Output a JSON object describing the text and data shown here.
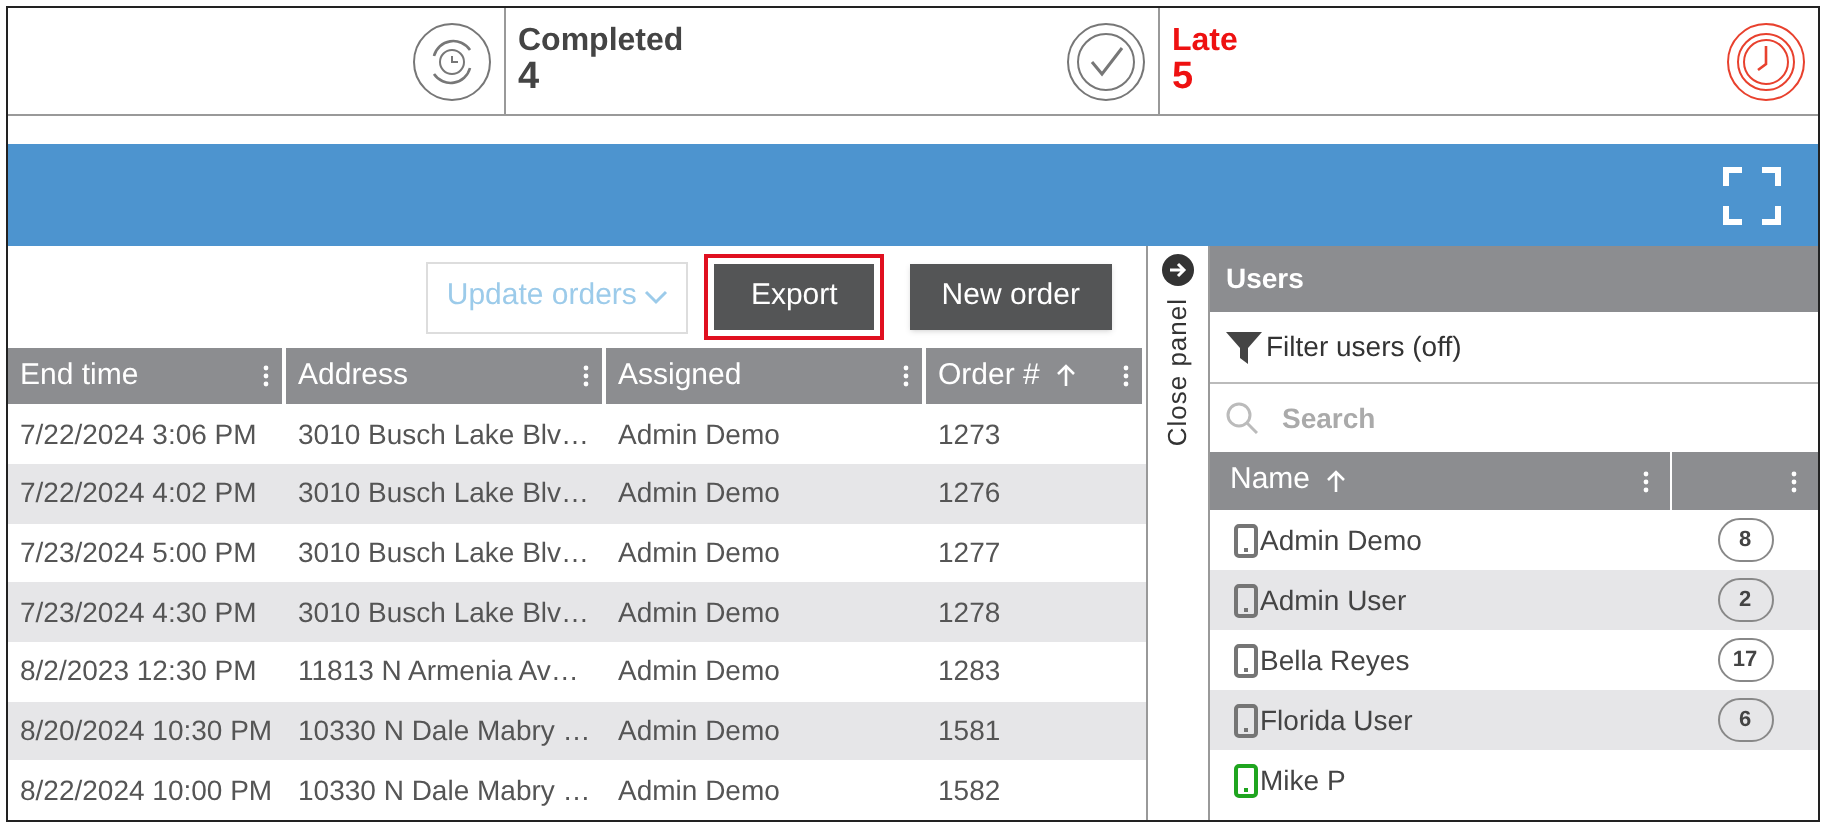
{
  "stats": [
    {
      "kind": "in_progress"
    },
    {
      "kind": "completed",
      "label": "Completed",
      "value": "4"
    },
    {
      "kind": "late",
      "label": "Late",
      "value": "5"
    }
  ],
  "toolbar": {
    "update": {
      "label": "Update orders",
      "disabled": true
    },
    "buttons": [
      {
        "label": "Export",
        "highlighted": true
      },
      {
        "label": "New order",
        "highlighted": false
      }
    ]
  },
  "table": {
    "columns": [
      {
        "label": "End time",
        "sorted": false
      },
      {
        "label": "Address",
        "sorted": false
      },
      {
        "label": "Assigned",
        "sorted": false
      },
      {
        "label": "Order #",
        "sorted": true
      }
    ],
    "rows": [
      [
        "7/22/2024 3:06 PM",
        "3010 Busch Lake Blv…",
        "Admin Demo",
        "1273"
      ],
      [
        "7/22/2024 4:02 PM",
        "3010 Busch Lake Blv…",
        "Admin Demo",
        "1276"
      ],
      [
        "7/23/2024 5:00 PM",
        "3010 Busch Lake Blv…",
        "Admin Demo",
        "1277"
      ],
      [
        "7/23/2024 4:30 PM",
        "3010 Busch Lake Blv…",
        "Admin Demo",
        "1278"
      ],
      [
        "8/2/2023 12:30 PM",
        "11813 N Armenia Av…",
        "Admin Demo",
        "1283"
      ],
      [
        "8/20/2024 10:30 PM",
        "10330 N Dale Mabry …",
        "Admin Demo",
        "1581"
      ],
      [
        "8/22/2024 10:00 PM",
        "10330 N Dale Mabry …",
        "Admin Demo",
        "1582"
      ]
    ]
  },
  "close_panel": "Close panel",
  "users": {
    "title": "Users",
    "filter": "Filter users (off)",
    "search": {
      "placeholder": "Search"
    },
    "columns": [
      {
        "label": "Name",
        "sorted": true
      },
      {
        "sorted": false
      }
    ],
    "rows": [
      {
        "name": "Admin Demo",
        "count": "8",
        "color": "#757575"
      },
      {
        "name": "Admin User",
        "count": "2",
        "color": "#757575"
      },
      {
        "name": "Bella Reyes",
        "count": "17",
        "color": "#757575"
      },
      {
        "name": "Florida User",
        "count": "6",
        "color": "#757575"
      },
      {
        "name": "Mike P",
        "color": "#1fa51f"
      }
    ]
  }
}
